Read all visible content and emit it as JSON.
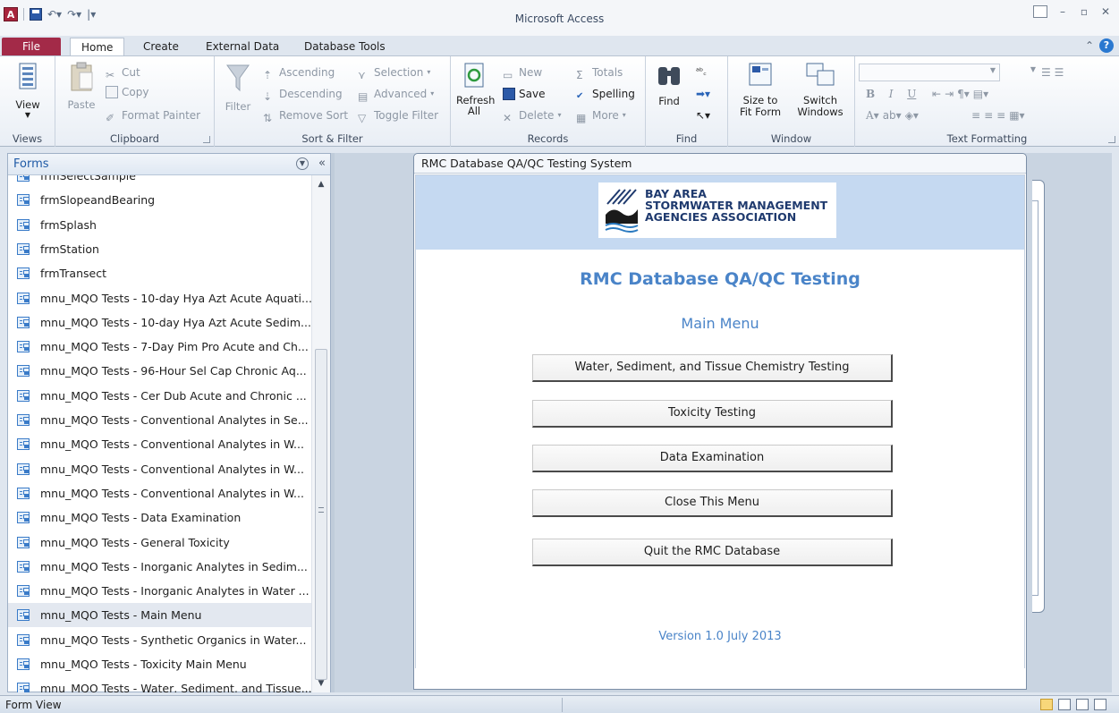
{
  "window": {
    "title": "Microsoft Access",
    "logo_letter": "A"
  },
  "tabs": [
    "File",
    "Home",
    "Create",
    "External Data",
    "Database Tools"
  ],
  "ribbon": {
    "views": {
      "label": "Views",
      "view_button": "View"
    },
    "clipboard": {
      "label": "Clipboard",
      "paste": "Paste",
      "cut": "Cut",
      "copy": "Copy",
      "format_painter": "Format Painter"
    },
    "sort_filter": {
      "label": "Sort & Filter",
      "filter": "Filter",
      "ascending": "Ascending",
      "descending": "Descending",
      "remove_sort": "Remove Sort",
      "selection": "Selection",
      "advanced": "Advanced",
      "toggle_filter": "Toggle Filter"
    },
    "records": {
      "label": "Records",
      "refresh": "Refresh",
      "refresh_all": "All",
      "new": "New",
      "save": "Save",
      "delete": "Delete",
      "totals": "Totals",
      "spelling": "Spelling",
      "more": "More"
    },
    "find": {
      "label": "Find",
      "find": "Find"
    },
    "window": {
      "label": "Window",
      "size_to": "Size to",
      "fit_form": "Fit Form",
      "switch": "Switch",
      "windows": "Windows"
    },
    "text_formatting": {
      "label": "Text Formatting"
    }
  },
  "nav": {
    "title": "Forms",
    "items": [
      "frmSelectSample",
      "frmSlopeandBearing",
      "frmSplash",
      "frmStation",
      "frmTransect",
      "mnu_MQO Tests - 10-day Hya Azt Acute Aquati...",
      "mnu_MQO Tests - 10-day Hya Azt Acute Sedim...",
      "mnu_MQO Tests - 7-Day Pim Pro Acute and Ch...",
      "mnu_MQO Tests - 96-Hour Sel Cap Chronic Aq...",
      "mnu_MQO Tests - Cer Dub Acute and Chronic ...",
      "mnu_MQO Tests - Conventional Analytes in Se...",
      "mnu_MQO Tests - Conventional Analytes in W...",
      "mnu_MQO Tests - Conventional Analytes in W...",
      "mnu_MQO Tests - Conventional Analytes in W...",
      "mnu_MQO Tests - Data Examination",
      "mnu_MQO Tests - General Toxicity",
      "mnu_MQO Tests - Inorganic Analytes in Sedim...",
      "mnu_MQO Tests - Inorganic Analytes in Water ...",
      "mnu_MQO Tests - Main Menu",
      "mnu_MQO Tests - Synthetic Organics in Water...",
      "mnu_MQO Tests - Toxicity Main Menu",
      "mnu_MQO Tests - Water, Sediment, and Tissue..."
    ],
    "selected_index": 18
  },
  "form": {
    "window_title": "RMC Database QA/QC Testing System",
    "logo_lines": [
      "BAY AREA",
      "STORMWATER MANAGEMENT",
      "AGENCIES ASSOCIATION"
    ],
    "heading": "RMC Database QA/QC Testing",
    "subheading": "Main Menu",
    "buttons": [
      "Water, Sediment, and Tissue Chemistry Testing",
      "Toxicity Testing",
      "Data Examination",
      "Close This Menu",
      "Quit the RMC Database"
    ],
    "footer": "Version 1.0 July 2013"
  },
  "status": {
    "text": "Form View"
  },
  "colors": {
    "file_tab": "#a32a48",
    "form_header": "#c5d9f1",
    "accent_text": "#4a84c8",
    "nav_title": "#1f5aa6"
  }
}
